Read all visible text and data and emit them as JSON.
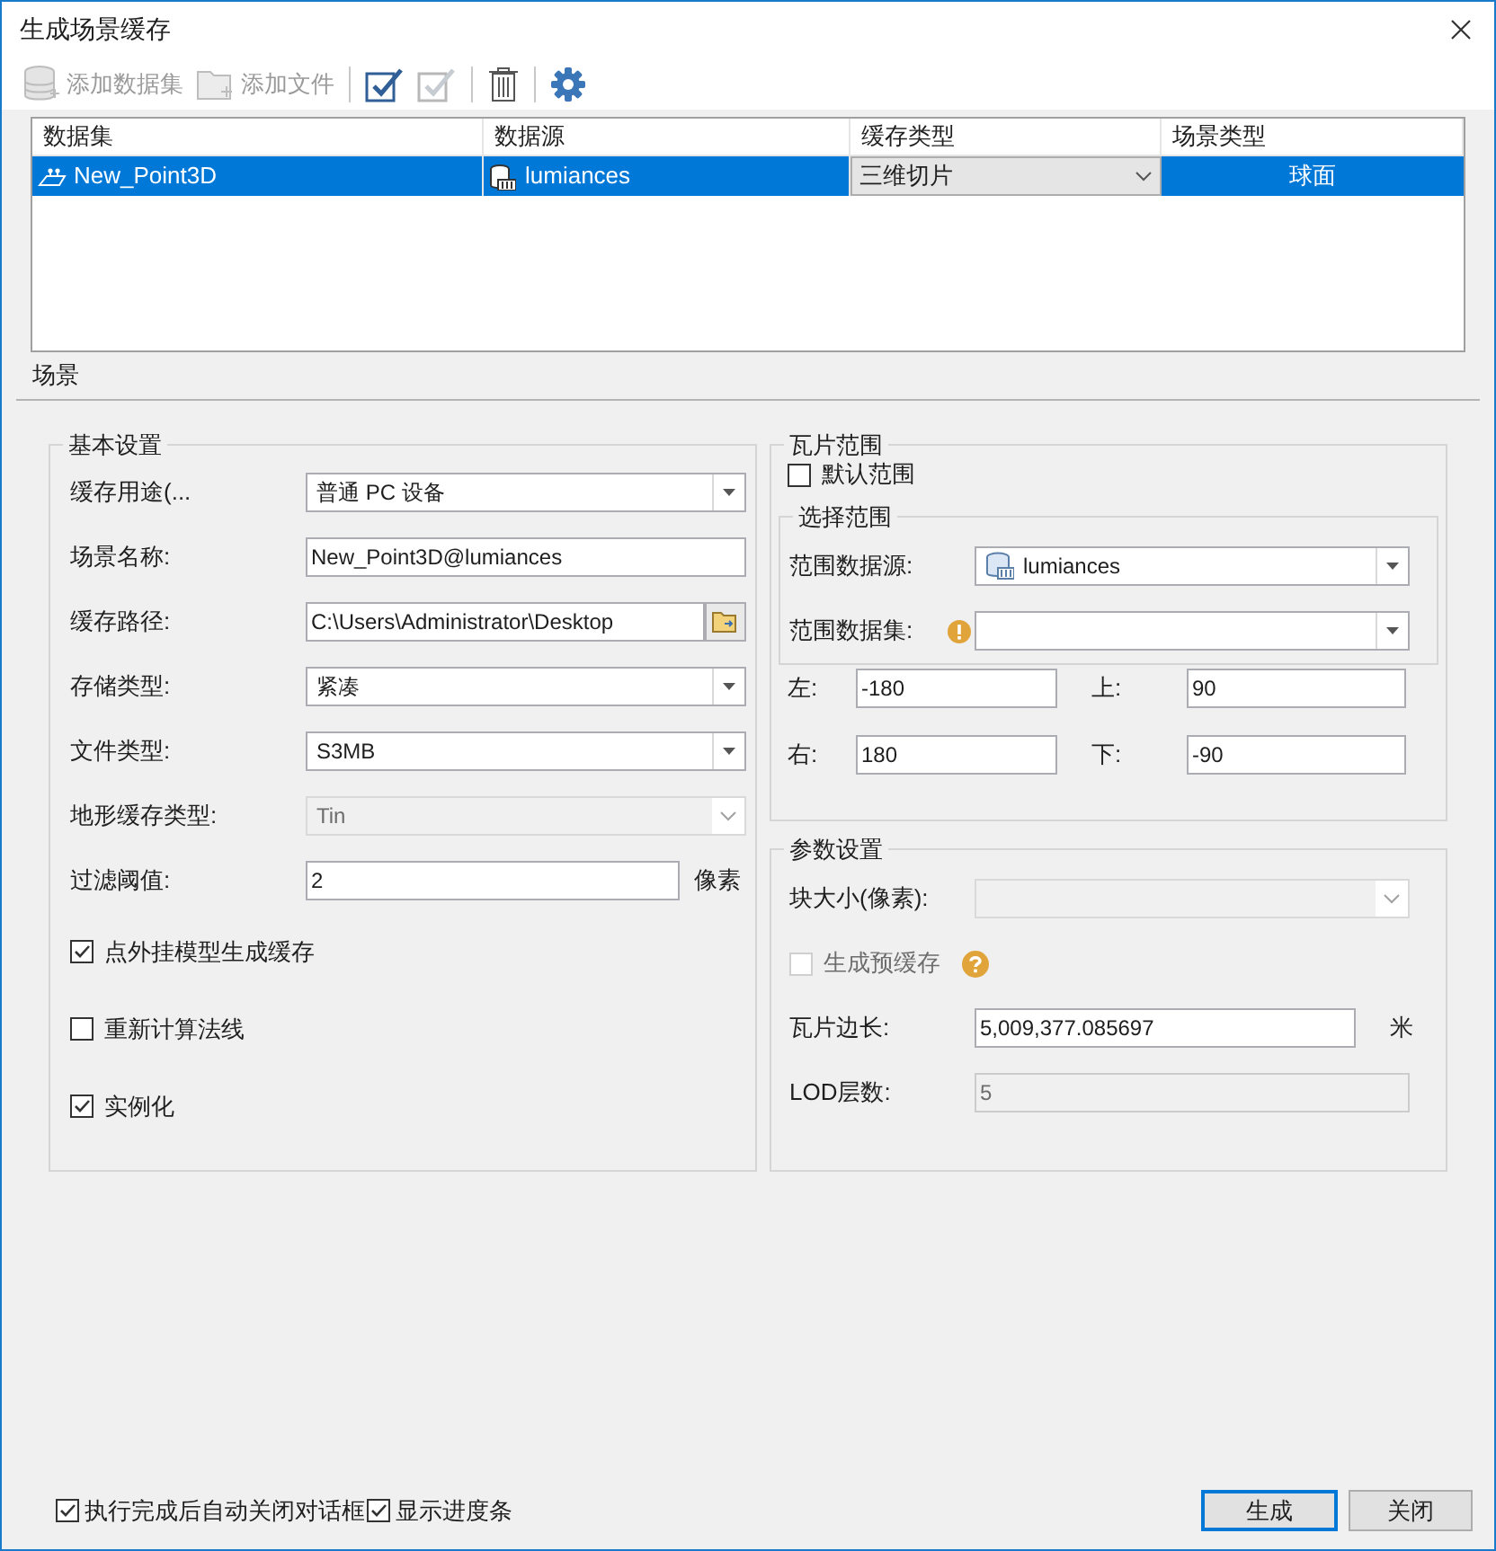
{
  "window": {
    "title": "生成场景缓存"
  },
  "toolbar": [
    {
      "kind": "add-dataset",
      "label": "添加数据集",
      "disabled": true
    },
    {
      "kind": "add-file",
      "label": "添加文件",
      "disabled": true
    },
    {
      "kind": "separator"
    },
    {
      "kind": "select-all",
      "disabled": false
    },
    {
      "kind": "select-none",
      "disabled": true
    },
    {
      "kind": "separator"
    },
    {
      "kind": "delete",
      "disabled": false
    },
    {
      "kind": "separator"
    },
    {
      "kind": "settings",
      "disabled": false
    }
  ],
  "table": {
    "columns": [
      "数据集",
      "数据源",
      "缓存类型",
      "场景类型"
    ],
    "rows": [
      {
        "selected": true,
        "dataset": "New_Point3D",
        "datasource": "lumiances",
        "cache_type": "三维切片",
        "scene_type": "球面"
      }
    ]
  },
  "tabs": [
    {
      "label": "场景",
      "selected": true
    }
  ],
  "basic_settings": {
    "title": "基本设置",
    "fields": [
      {
        "kind": "dropdown",
        "label": "缓存用途(...",
        "value": "普通 PC 设备",
        "disabled": false
      },
      {
        "kind": "text",
        "label": "场景名称:",
        "value": "New_Point3D@lumiances"
      },
      {
        "kind": "path",
        "label": "缓存路径:",
        "value": "C:\\Users\\Administrator\\Desktop"
      },
      {
        "kind": "dropdown",
        "label": "存储类型:",
        "value": "紧凑",
        "disabled": false
      },
      {
        "kind": "dropdown",
        "label": "文件类型:",
        "value": "S3MB",
        "disabled": false
      },
      {
        "kind": "dropdown",
        "label": "地形缓存类型:",
        "value": "Tin",
        "disabled": true
      },
      {
        "kind": "text",
        "label": "过滤阈值:",
        "value": "2",
        "unit": "像素"
      }
    ],
    "checkboxes": [
      {
        "label": "点外挂模型生成缓存",
        "checked": true
      },
      {
        "label": "重新计算法线",
        "checked": false
      },
      {
        "label": "实例化",
        "checked": true
      }
    ]
  },
  "tile_range": {
    "title": "瓦片范围",
    "default_range": {
      "label": "默认范围",
      "checked": false
    },
    "select_range": {
      "title": "选择范围",
      "fields": [
        {
          "label": "范围数据源:",
          "value": "lumiances",
          "warning": false
        },
        {
          "label": "范围数据集:",
          "warning": true
        }
      ]
    },
    "bounds": [
      {
        "label": "左:",
        "value": "-180"
      },
      {
        "label": "上:",
        "value": "90"
      },
      {
        "label": "右:",
        "value": "180"
      },
      {
        "label": "下:",
        "value": "-90"
      }
    ]
  },
  "parameters": {
    "title": "参数设置",
    "block_size": {
      "label": "块大小(像素):",
      "disabled": true
    },
    "pre_cache": {
      "label": "生成预缓存",
      "checked": false,
      "disabled": true
    },
    "tile_length": {
      "label": "瓦片边长:",
      "value": "5,009,377.085697",
      "unit": "米"
    },
    "lod": {
      "label": "LOD层数:",
      "value": "5",
      "disabled": true
    }
  },
  "footer": {
    "checkboxes": [
      {
        "label": "执行完成后自动关闭对话框",
        "checked": true
      },
      {
        "label": "显示进度条",
        "checked": true
      }
    ],
    "buttons": [
      {
        "label": "生成",
        "default": true
      },
      {
        "label": "关闭",
        "default": false
      }
    ]
  }
}
